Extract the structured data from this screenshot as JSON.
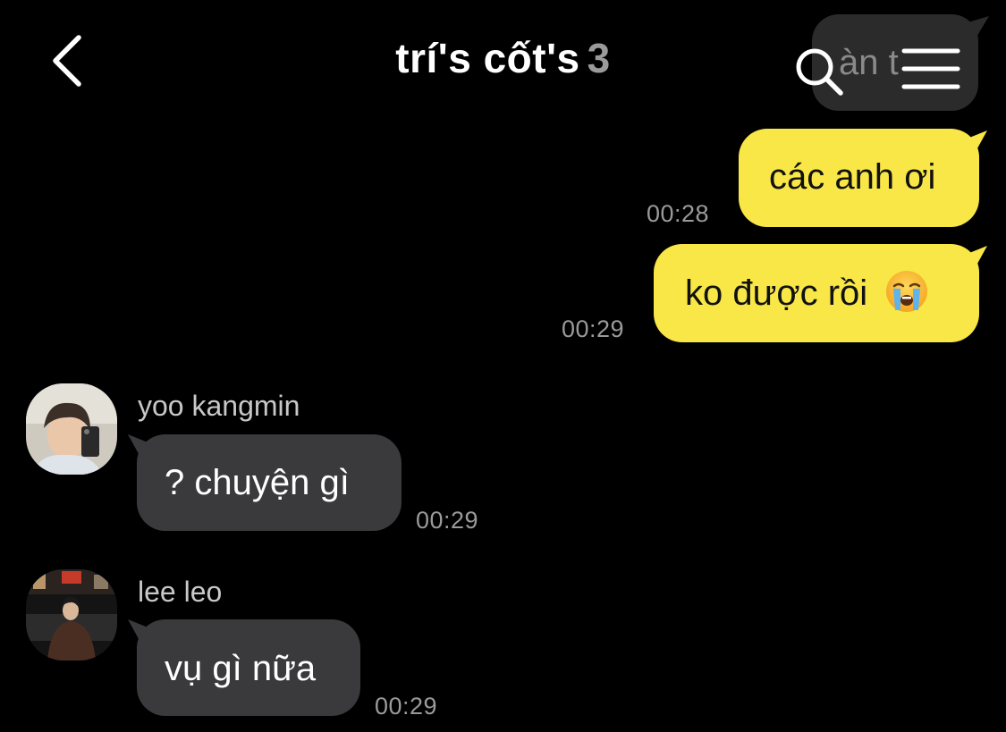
{
  "header": {
    "title": "trí's cốt's",
    "member_count": "3"
  },
  "hidden_bubble": {
    "text": "àn t"
  },
  "messages": [
    {
      "direction": "out",
      "text": "các anh ơi",
      "time": "00:28"
    },
    {
      "direction": "out",
      "text": "ko được rồi",
      "emoji": "crying-face",
      "time": "00:29"
    },
    {
      "direction": "in",
      "sender": "yoo kangmin",
      "text": "? chuyện gì",
      "time": "00:29"
    },
    {
      "direction": "in",
      "sender": "lee leo",
      "text": "vụ gì nữa",
      "time": "00:29"
    }
  ],
  "colors": {
    "background": "#000000",
    "outgoing_bubble": "#f8e746",
    "incoming_bubble": "#3a3a3c",
    "timestamp": "#9a9a9a"
  }
}
